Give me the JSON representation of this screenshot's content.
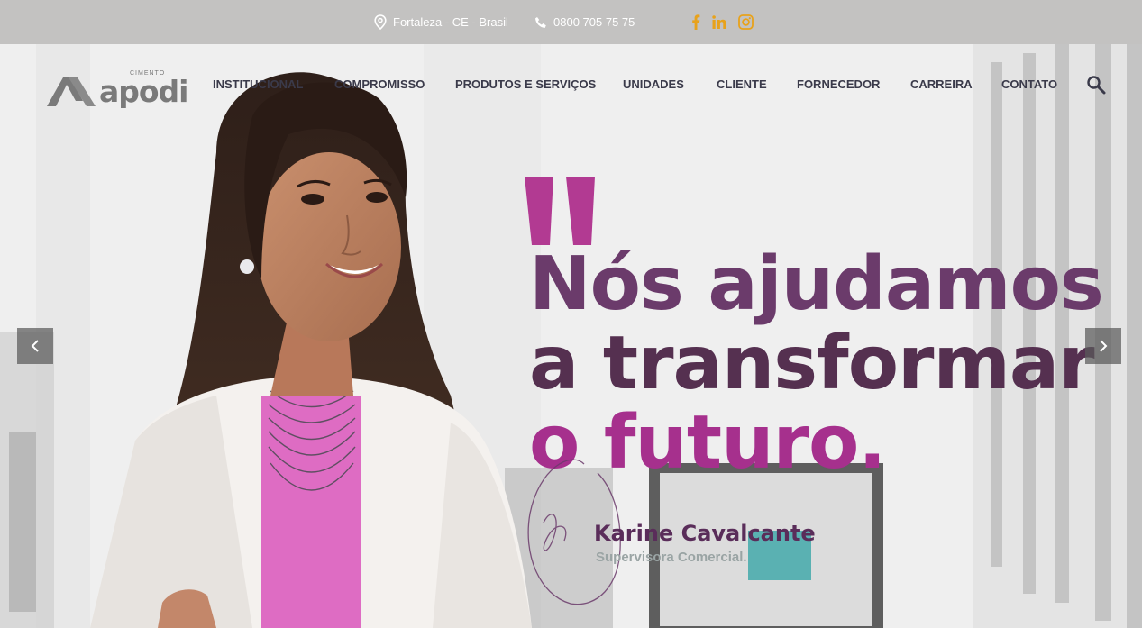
{
  "topbar": {
    "location": "Fortaleza - CE - Brasil",
    "phone": "0800 705 75 75",
    "social": [
      "facebook-icon",
      "linkedin-icon",
      "instagram-icon"
    ],
    "social_color": "#e8a21b"
  },
  "logo": {
    "small": "CIMENTO",
    "word": "apodi"
  },
  "nav": {
    "items": [
      "INSTITUCIONAL",
      "COMPROMISSO",
      "PRODUTOS E SERVIÇOS",
      "UNIDADES",
      "CLIENTE",
      "FORNECEDOR",
      "CARREIRA",
      "CONTATO"
    ]
  },
  "hero": {
    "quote_color": "#b23a92",
    "headline": [
      "Nós ajudamos",
      "a transformar",
      "o futuro."
    ],
    "person_name": "Karine Cavalcante",
    "person_role": "Supervisora Comercial."
  }
}
